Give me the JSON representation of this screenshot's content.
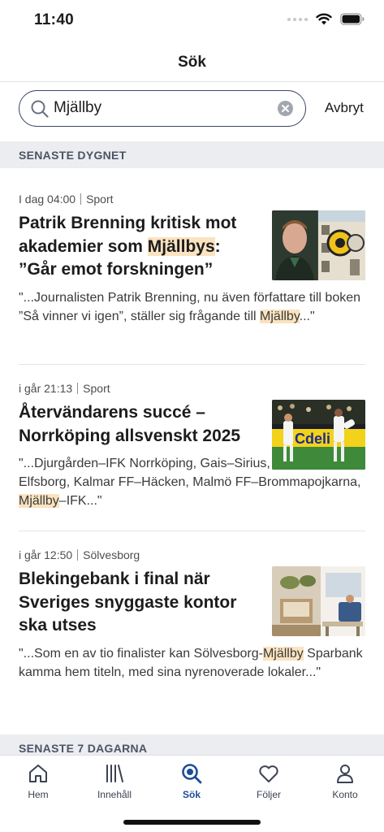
{
  "status": {
    "time": "11:40"
  },
  "nav": {
    "title": "Sök"
  },
  "search": {
    "value": "Mjällby",
    "cancel_label": "Avbryt"
  },
  "sections": {
    "recent_day": "SENASTE DYGNET",
    "recent_week": "SENASTE 7 DAGARNA"
  },
  "articles": [
    {
      "time": "I dag 04:00",
      "category": "Sport",
      "headline_pre": "Patrik Brenning kritisk mot akademier som ",
      "headline_hl": "Mjällbys",
      "headline_post": ": ”Går emot forskningen”",
      "snippet_pre": "\"...Journalisten Patrik Brenning, nu även författare till boken ”Så vinner vi igen”, ställer sig frågande till ",
      "snippet_hl": "Mjällby",
      "snippet_post": "...\""
    },
    {
      "time": "i går 21:13",
      "category": "Sport",
      "headline_pre": "Återvändarens succé – Norrköping allsvenskt 2025",
      "headline_hl": "",
      "headline_post": "",
      "snippet_pre": "\"...Djurgården–IFK Norrköping, Gais–Sirius, Värnamo–Elfsborg, Kalmar FF–Häcken, Malmö FF–Brommapojkarna, ",
      "snippet_hl": "Mjällby",
      "snippet_post": "–IFK...\""
    },
    {
      "time": "i går 12:50",
      "category": "Sölvesborg",
      "headline_pre": "Blekingebank i final när Sveriges snyggaste kontor ska utses",
      "headline_hl": "",
      "headline_post": "",
      "snippet_pre": "\"...Som en av tio finalister kan Sölvesborg-",
      "snippet_hl": "Mjällby",
      "snippet_post": " Sparbank kamma hem titeln, med sina nyrenoverade lokaler...\""
    }
  ],
  "tabs": [
    {
      "label": "Hem",
      "icon": "home-icon"
    },
    {
      "label": "Innehåll",
      "icon": "library-icon"
    },
    {
      "label": "Sök",
      "icon": "search-icon"
    },
    {
      "label": "Följer",
      "icon": "heart-icon"
    },
    {
      "label": "Konto",
      "icon": "person-icon"
    }
  ],
  "colors": {
    "highlight": "#fae3bf",
    "active_tab": "#1e4d96",
    "section_bg": "#ecedf0"
  }
}
